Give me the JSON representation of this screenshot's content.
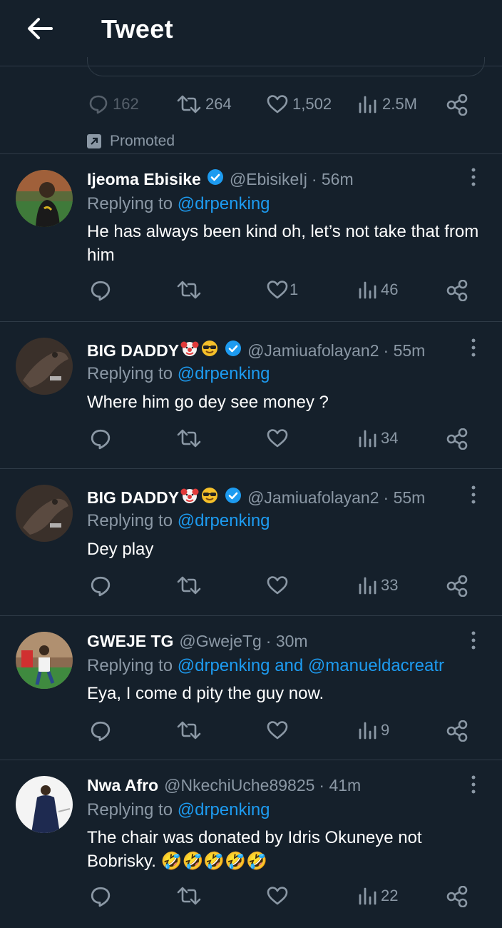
{
  "header": {
    "title": "Tweet"
  },
  "main_tweet": {
    "replies": "162",
    "retweets": "264",
    "likes": "1,502",
    "views": "2.5M",
    "promoted_label": "Promoted"
  },
  "replies": [
    {
      "name": "Ijeoma Ebisike",
      "handle": "@EbisikeIj",
      "time": "· 56m",
      "replying_prefix": "Replying to",
      "replying_to": "@drpenking",
      "text": "He has always been kind oh, let’s not take that from him",
      "replies": "",
      "retweets": "",
      "likes": "1",
      "views": "46"
    },
    {
      "name": "BIG DADDY",
      "handle": "@Jamiuafolayan2",
      "time": "· 55m",
      "replying_prefix": "Replying to",
      "replying_to": "@drpenking",
      "text": "Where him go dey see money ?",
      "replies": "",
      "retweets": "",
      "likes": "",
      "views": "34"
    },
    {
      "name": "BIG DADDY",
      "handle": "@Jamiuafolayan2",
      "time": "· 55m",
      "replying_prefix": "Replying to",
      "replying_to": "@drpenking",
      "text": "Dey play",
      "replies": "",
      "retweets": "",
      "likes": "",
      "views": "33"
    },
    {
      "name": "GWEJE TG",
      "handle": "@GwejeTg",
      "time": "· 30m",
      "replying_prefix": "Replying to",
      "replying_to": "@drpenking and @manueldacreatr",
      "text": "Eya, I come d pity the guy now.",
      "replies": "",
      "retweets": "",
      "likes": "",
      "views": "9"
    },
    {
      "name": "Nwa Afro",
      "handle": "@NkechiUche89825",
      "time": "· 41m",
      "replying_prefix": "Replying to",
      "replying_to": "@drpenking",
      "text": "The chair was donated by Idris Okuneye not Bobrisky. 🤣🤣🤣🤣🤣",
      "replies": "",
      "retweets": "",
      "likes": "",
      "views": "22"
    }
  ],
  "colors": {
    "background": "#15202b",
    "muted": "#8b98a5",
    "link": "#1d9bf0",
    "divider": "#2f3b47"
  }
}
